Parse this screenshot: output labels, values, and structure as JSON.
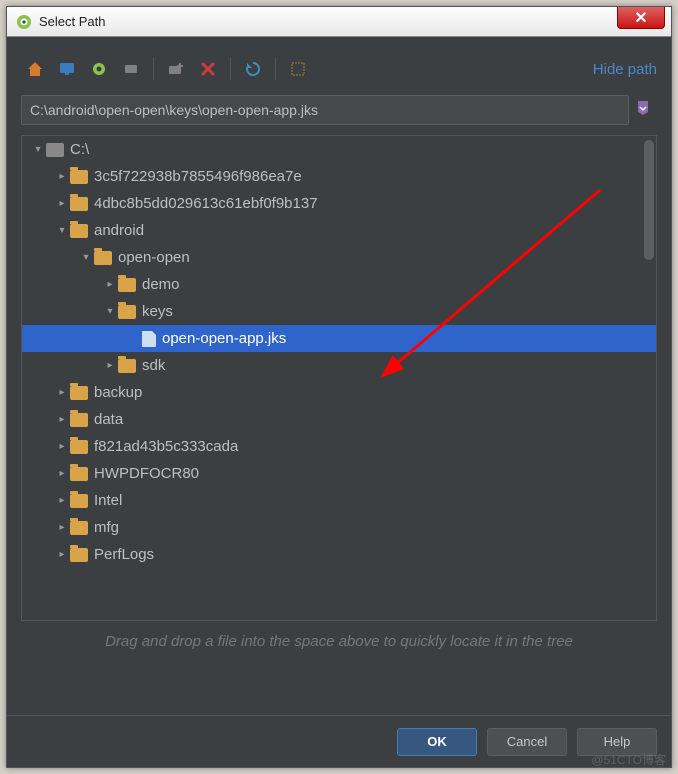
{
  "window": {
    "title": "Select Path"
  },
  "toolbar": {
    "hide_path": "Hide path",
    "icons": [
      "home",
      "desktop",
      "project",
      "module",
      "module-gray",
      "delete",
      "refresh",
      "show-hidden"
    ]
  },
  "path": {
    "value": "C:\\android\\open-open\\keys\\open-open-app.jks"
  },
  "tree": {
    "items": [
      {
        "depth": 0,
        "arrow": "exp",
        "kind": "drive",
        "label": "C:\\",
        "selected": false
      },
      {
        "depth": 1,
        "arrow": "col",
        "kind": "folder",
        "label": "3c5f722938b7855496f986ea7e",
        "selected": false
      },
      {
        "depth": 1,
        "arrow": "col",
        "kind": "folder",
        "label": "4dbc8b5dd029613c61ebf0f9b137",
        "selected": false
      },
      {
        "depth": 1,
        "arrow": "exp",
        "kind": "folder",
        "label": "android",
        "selected": false
      },
      {
        "depth": 2,
        "arrow": "exp",
        "kind": "folder",
        "label": "open-open",
        "selected": false
      },
      {
        "depth": 3,
        "arrow": "col",
        "kind": "folder",
        "label": "demo",
        "selected": false
      },
      {
        "depth": 3,
        "arrow": "exp",
        "kind": "folder",
        "label": "keys",
        "selected": false
      },
      {
        "depth": 4,
        "arrow": "",
        "kind": "file",
        "label": "open-open-app.jks",
        "selected": true
      },
      {
        "depth": 3,
        "arrow": "col",
        "kind": "folder",
        "label": "sdk",
        "selected": false
      },
      {
        "depth": 1,
        "arrow": "col",
        "kind": "folder",
        "label": "backup",
        "selected": false
      },
      {
        "depth": 1,
        "arrow": "col",
        "kind": "folder",
        "label": "data",
        "selected": false
      },
      {
        "depth": 1,
        "arrow": "col",
        "kind": "folder",
        "label": "f821ad43b5c333cada",
        "selected": false
      },
      {
        "depth": 1,
        "arrow": "col",
        "kind": "folder",
        "label": "HWPDFOCR80",
        "selected": false
      },
      {
        "depth": 1,
        "arrow": "col",
        "kind": "folder",
        "label": "Intel",
        "selected": false
      },
      {
        "depth": 1,
        "arrow": "col",
        "kind": "folder",
        "label": "mfg",
        "selected": false
      },
      {
        "depth": 1,
        "arrow": "col",
        "kind": "folder",
        "label": "PerfLogs",
        "selected": false
      }
    ],
    "hint": "Drag and drop a file into the space above to quickly locate it in the tree"
  },
  "footer": {
    "ok": "OK",
    "cancel": "Cancel",
    "help": "Help"
  },
  "watermark": "@51CTO博客"
}
